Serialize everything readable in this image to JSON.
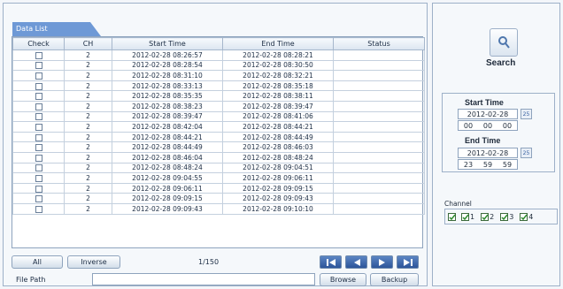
{
  "tab": {
    "label": "Data List"
  },
  "columns": [
    "Check",
    "CH",
    "Start Time",
    "End Time",
    "Status"
  ],
  "rows": [
    {
      "ch": "2",
      "start": "2012-02-28 08:26:57",
      "end": "2012-02-28 08:28:21",
      "status": ""
    },
    {
      "ch": "2",
      "start": "2012-02-28 08:28:54",
      "end": "2012-02-28 08:30:50",
      "status": ""
    },
    {
      "ch": "2",
      "start": "2012-02-28 08:31:10",
      "end": "2012-02-28 08:32:21",
      "status": ""
    },
    {
      "ch": "2",
      "start": "2012-02-28 08:33:13",
      "end": "2012-02-28 08:35:18",
      "status": ""
    },
    {
      "ch": "2",
      "start": "2012-02-28 08:35:35",
      "end": "2012-02-28 08:38:11",
      "status": ""
    },
    {
      "ch": "2",
      "start": "2012-02-28 08:38:23",
      "end": "2012-02-28 08:39:47",
      "status": ""
    },
    {
      "ch": "2",
      "start": "2012-02-28 08:39:47",
      "end": "2012-02-28 08:41:06",
      "status": ""
    },
    {
      "ch": "2",
      "start": "2012-02-28 08:42:04",
      "end": "2012-02-28 08:44:21",
      "status": ""
    },
    {
      "ch": "2",
      "start": "2012-02-28 08:44:21",
      "end": "2012-02-28 08:44:49",
      "status": ""
    },
    {
      "ch": "2",
      "start": "2012-02-28 08:44:49",
      "end": "2012-02-28 08:46:03",
      "status": ""
    },
    {
      "ch": "2",
      "start": "2012-02-28 08:46:04",
      "end": "2012-02-28 08:48:24",
      "status": ""
    },
    {
      "ch": "2",
      "start": "2012-02-28 08:48:24",
      "end": "2012-02-28 09:04:51",
      "status": ""
    },
    {
      "ch": "2",
      "start": "2012-02-28 09:04:55",
      "end": "2012-02-28 09:06:11",
      "status": ""
    },
    {
      "ch": "2",
      "start": "2012-02-28 09:06:11",
      "end": "2012-02-28 09:09:15",
      "status": ""
    },
    {
      "ch": "2",
      "start": "2012-02-28 09:09:15",
      "end": "2012-02-28 09:09:43",
      "status": ""
    },
    {
      "ch": "2",
      "start": "2012-02-28 09:09:43",
      "end": "2012-02-28 09:10:10",
      "status": ""
    }
  ],
  "controls": {
    "all_label": "All",
    "inverse_label": "Inverse",
    "page_indicator": "1/150"
  },
  "file_path": {
    "label": "File Path",
    "value": "",
    "browse_label": "Browse",
    "backup_label": "Backup"
  },
  "search": {
    "label": "Search",
    "icon": "search-icon"
  },
  "start_time": {
    "label": "Start Time",
    "date": "2012-02-28",
    "hh": "00",
    "mm": "00",
    "ss": "00"
  },
  "end_time": {
    "label": "End Time",
    "date": "2012-02-28",
    "hh": "23",
    "mm": "59",
    "ss": "59"
  },
  "calendar_icon_text": "25",
  "channel": {
    "label": "Channel",
    "items": [
      "1",
      "2",
      "3",
      "4"
    ]
  },
  "colors": {
    "tab": "#6e99d6",
    "nav_button": "#2c5499",
    "check_green": "#2e8b2e"
  }
}
